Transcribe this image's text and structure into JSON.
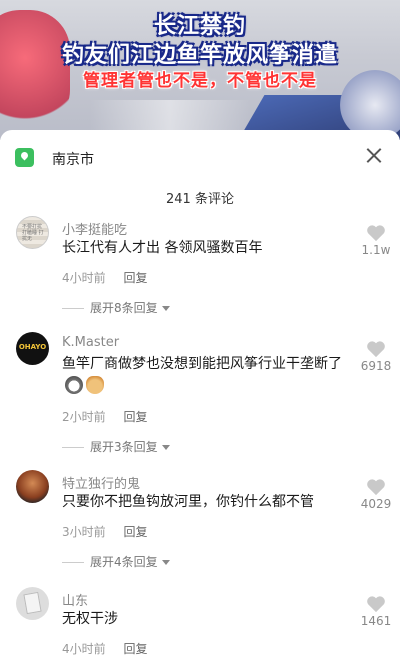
{
  "video": {
    "line1": "长江禁钓",
    "line2": "钓友们江边鱼竿放风筝消遣",
    "line3": "管理者管也不是，不管也不是"
  },
  "location": {
    "icon": "location-pin-icon",
    "text": "南京市"
  },
  "comment_count": "241 条评论",
  "comments": [
    {
      "username": "小李挺能吃",
      "text": "长江代有人才出 各领风骚数百年",
      "time": "4小时前",
      "reply": "回复",
      "expand": "展开8条回复",
      "likes": "1.1w",
      "avatar_text": "不要打扰 打瞌睡 打扰无"
    },
    {
      "username": "K.Master",
      "text": "鱼竿厂商做梦也没想到能把风筝行业干垄断了",
      "time": "2小时前",
      "reply": "回复",
      "expand": "展开3条回复",
      "likes": "6918",
      "avatar_text": "OHAYO"
    },
    {
      "username": "特立独行的鬼",
      "text": "只要你不把鱼钩放河里，你钓什么都不管",
      "time": "3小时前",
      "reply": "回复",
      "expand": "展开4条回复",
      "likes": "4029"
    },
    {
      "username": "山东",
      "text": "无权干涉",
      "time": "4小时前",
      "reply": "回复",
      "likes": "1461"
    }
  ],
  "colors": {
    "accent_red": "#ff3434",
    "location_green": "#3cbf5f",
    "banner_outline": "#1a2a8a"
  }
}
